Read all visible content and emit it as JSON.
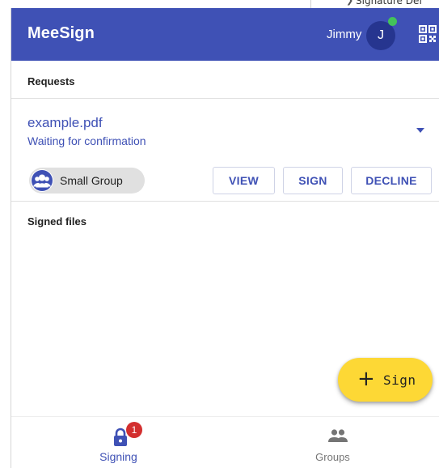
{
  "background_window": {
    "partial_text": "Signature Def"
  },
  "appbar": {
    "title": "MeeSign",
    "user_name": "Jimmy",
    "avatar_initial": "J",
    "brand_color": "#3f51b5",
    "online_indicator_color": "#43c35a",
    "qr_icon": "qr-code-icon"
  },
  "requests": {
    "header": "Requests",
    "items": [
      {
        "file_name": "example.pdf",
        "status": "Waiting for confirmation",
        "group": "Small Group",
        "group_icon": "group-icon",
        "expand_icon": "dropdown-arrow-icon",
        "actions": {
          "view": "VIEW",
          "sign": "SIGN",
          "decline": "DECLINE"
        }
      }
    ]
  },
  "signed_files": {
    "header": "Signed files"
  },
  "fab": {
    "icon": "plus-icon",
    "label": "Sign",
    "color": "#fdd835"
  },
  "bottom_nav": {
    "items": [
      {
        "label": "Signing",
        "icon": "lock-icon",
        "badge": "1",
        "active": true
      },
      {
        "label": "Groups",
        "icon": "people-icon",
        "active": false
      }
    ],
    "badge_color": "#d32f2f"
  }
}
